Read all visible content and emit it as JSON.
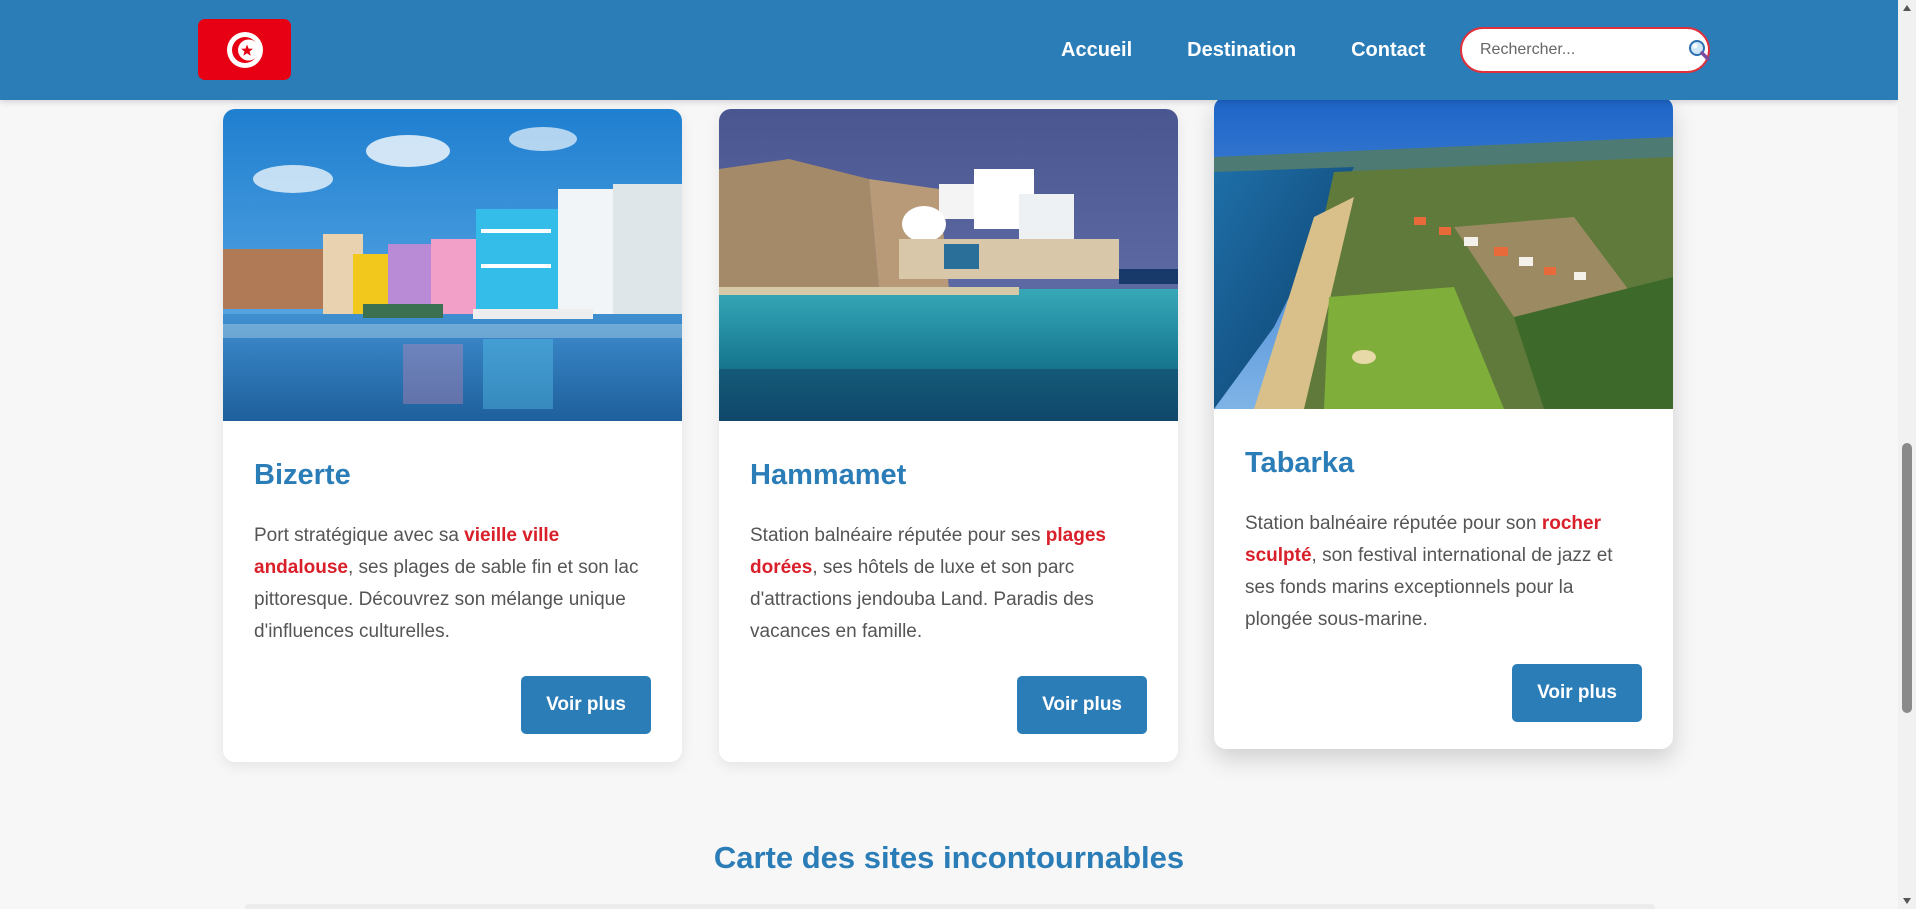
{
  "header": {
    "logo_alt": "Drapeau de la Tunisie",
    "nav": [
      {
        "label": "Accueil"
      },
      {
        "label": "Destination"
      },
      {
        "label": "Contact"
      }
    ],
    "search": {
      "placeholder": "Rechercher...",
      "value": "",
      "icon": "search-icon"
    }
  },
  "cards": [
    {
      "title": "Bizerte",
      "text_before": "Port stratégique avec sa ",
      "highlight": "vieille ville andalouse",
      "text_after": ", ses plages de sable fin et son lac pittoresque. Découvrez son mélange unique d'influences culturelles.",
      "button": "Voir plus"
    },
    {
      "title": "Hammamet",
      "text_before": "Station balnéaire réputée pour ses ",
      "highlight": "plages dorées",
      "text_after": ", ses hôtels de luxe et son parc d'attractions jendouba Land. Paradis des vacances en famille.",
      "button": "Voir plus"
    },
    {
      "title": "Tabarka",
      "text_before": "Station balnéaire réputée pour son ",
      "highlight": "rocher sculpté",
      "text_after": ", son festival international de jazz et ses fonds marins exceptionnels pour la plongée sous-marine.",
      "button": "Voir plus"
    }
  ],
  "section": {
    "title": "Carte des sites incontournables"
  },
  "colors": {
    "primary": "#2b7db8",
    "accent": "#d9202a",
    "flag_red": "#e70013"
  }
}
